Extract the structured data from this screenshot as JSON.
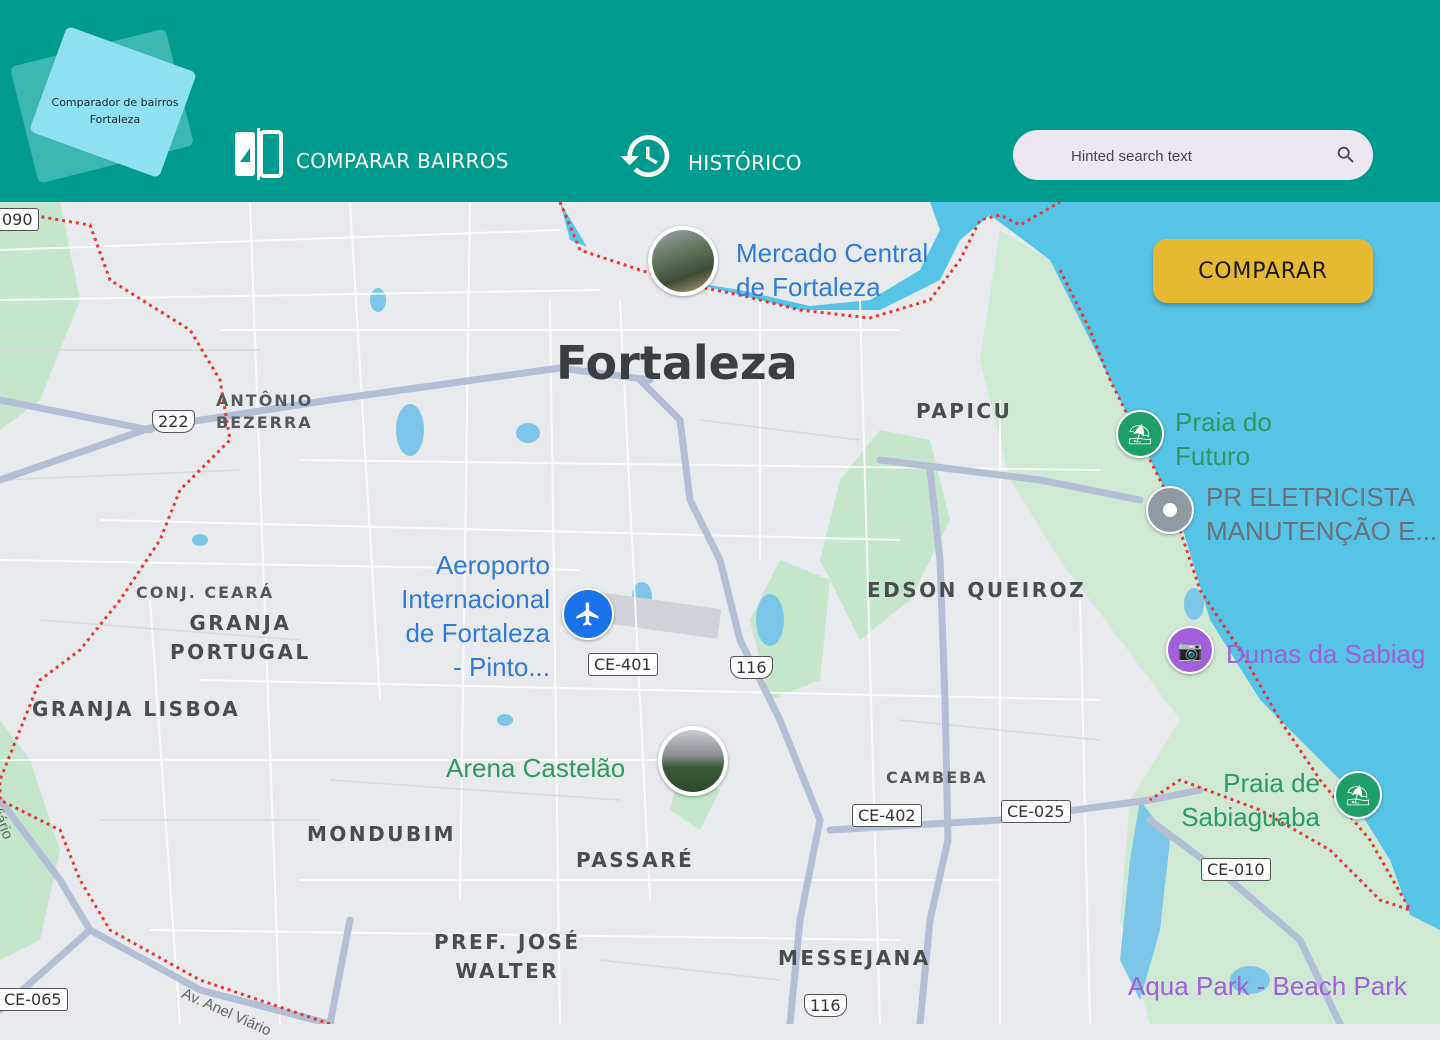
{
  "app": {
    "logo_line1": "Comparador de bairros",
    "logo_line2": "Fortaleza"
  },
  "nav": {
    "compare_label": "COMPARAR BAIRROS",
    "history_label": "HISTÓRICO"
  },
  "search": {
    "placeholder": "Hinted search text"
  },
  "compare_button": "COMPARAR",
  "map": {
    "city": "Fortaleza",
    "neighborhoods": {
      "antonio_bezerra": [
        "ANTÔNIO",
        "BEZERRA"
      ],
      "papicu": "PAPICU",
      "conj_ceara": "CONJ. CEARÁ",
      "granja_portugal": [
        "GRANJA",
        "PORTUGAL"
      ],
      "granja_lisboa": "GRANJA LISBOA",
      "edson_queiroz": "EDSON QUEIROZ",
      "cambeba": "CAMBEBA",
      "mondubim": "MONDUBIM",
      "passare": "PASSARÉ",
      "pref_jose_walter": [
        "PREF. JOSÉ",
        "WALTER"
      ],
      "messejana": "MESSEJANA"
    },
    "pois": {
      "mercado": [
        "Mercado Central",
        "de Fortaleza"
      ],
      "aeroporto": [
        "Aeroporto",
        "Internacional",
        "de Fortaleza",
        "- Pinto..."
      ],
      "arena": "Arena Castelão",
      "praia_futuro": [
        "Praia do",
        "Futuro"
      ],
      "eletricista": [
        "PR ELETRICISTA",
        "MANUTENÇÃO E..."
      ],
      "dunas": "Dunas da Sabiag",
      "praia_sabiaguaba": [
        "Praia de",
        "Sabiaguaba"
      ],
      "aqua_park": "Aqua Park - Beach Park",
      "av_anel": "Av. Anel Viário",
      "anel_edge": "Viário"
    },
    "roads": {
      "r222": "222",
      "ce401": "CE-401",
      "r116a": "116",
      "r116b": "116",
      "ce402": "CE-402",
      "ce025": "CE-025",
      "ce010": "CE-010",
      "ce065": "CE-065",
      "r090": "090"
    },
    "colors": {
      "sea": "#56c4e6",
      "boundary": "#e53935",
      "park": "#c3e6cc"
    }
  }
}
